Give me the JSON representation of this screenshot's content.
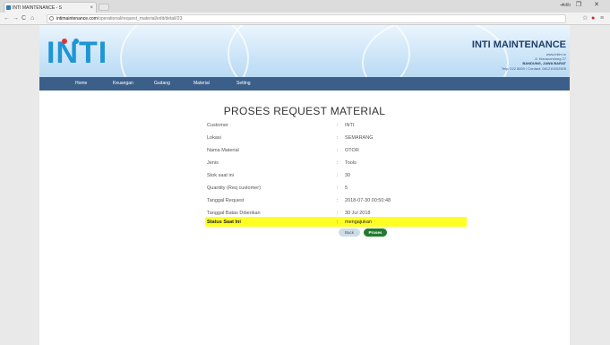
{
  "browser": {
    "tab_title": "INTI MAINTENANCE - S",
    "tab_close": "×",
    "user_label": "Adib",
    "window_buttons": "– ❐ ✕",
    "nav_back": "←",
    "nav_forward": "→",
    "nav_reload": "C",
    "nav_home": "⌂",
    "url_host": "intimaintenance.com",
    "url_prefix": "",
    "url_path": "/operational/request_material/edit/detail/23",
    "ext_star": "☆"
  },
  "header": {
    "logo_text": "INTI",
    "company_name": "INTI MAINTENANCE",
    "company_line1": "www.intim.in",
    "company_line2": "Jl. Kiaracondong 27",
    "company_line3": "BANDUNG, JAWA BARAT",
    "company_line4": "Telp: 022 8000 / Contact: 081210002505"
  },
  "menu": {
    "items": [
      "Home",
      "Keuangan",
      "Gudang",
      "Material",
      "Setting"
    ]
  },
  "content": {
    "title": "PROSES REQUEST MATERIAL",
    "rows": [
      {
        "label": "Customer",
        "value": "INTI"
      },
      {
        "label": "Lokasi",
        "value": "SEMARANG"
      },
      {
        "label": "Nama Material",
        "value": "OTOR"
      },
      {
        "label": "Jenis",
        "value": "Tools"
      },
      {
        "label": "Stok saat ini",
        "value": "30"
      },
      {
        "label": "Quantity (Req customer)",
        "value": "5"
      },
      {
        "label": "Tanggal Request",
        "value": "2018-07-30 00:50:48"
      },
      {
        "label": "Tanggal Batas Diberikan",
        "value": "30 Jul 2018"
      },
      {
        "label": "Status Saat Ini",
        "value": "mengajukan"
      }
    ],
    "colon": ":",
    "back_button": "Back",
    "proses_button": "Proses"
  },
  "colors": {
    "menu_bar": "#3c5f8a",
    "highlight": "#ffff24",
    "proses_button": "#217a2f",
    "logo": "#1e95d6"
  }
}
